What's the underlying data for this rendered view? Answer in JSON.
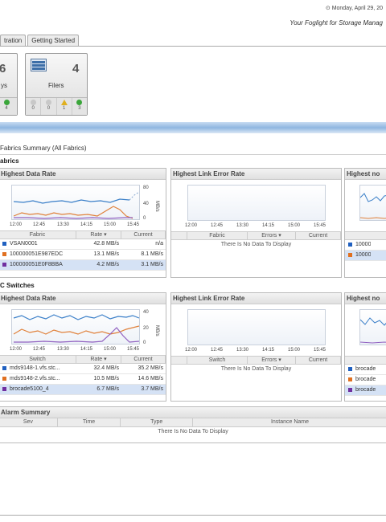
{
  "header": {
    "date": "Monday, April 29, 20",
    "tagline": "Your Foglight for Storage Manag"
  },
  "tabs": [
    {
      "label": "tration"
    },
    {
      "label": "Getting Started"
    }
  ],
  "tiles": {
    "arrays": {
      "count": "6",
      "name": "ys",
      "stat_last": "4"
    },
    "filers": {
      "count": "4",
      "name": "Filers",
      "stats": [
        "0",
        "0",
        "1",
        "3"
      ]
    }
  },
  "summary_title": "Fabrics Summary (All Fabrics)",
  "fabrics": {
    "section_title": "abrics",
    "rate_panel": {
      "title": "Highest Data Rate",
      "y_unit": "MB/s",
      "y_ticks": [
        "80",
        "40",
        "0"
      ],
      "x_ticks": [
        "12:00",
        "12:45",
        "13:30",
        "14:15",
        "15:00",
        "15:45"
      ],
      "columns": [
        "Fabric",
        "Rate ▾",
        "Current"
      ],
      "rows": [
        {
          "name": "VSAN0001",
          "rate": "42.8 MB/s",
          "current": "n/a",
          "color": "#2060c0"
        },
        {
          "name": "100000051E987EDC",
          "rate": "13.1 MB/s",
          "current": "8.1 MB/s",
          "color": "#e07020"
        },
        {
          "name": "100000051E0F8BBA",
          "rate": "4.2 MB/s",
          "current": "3.1 MB/s",
          "color": "#7030a0"
        }
      ]
    },
    "error_panel": {
      "title": "Highest Link Error Rate",
      "x_ticks": [
        "12:00",
        "12:45",
        "13:30",
        "14:15",
        "15:00",
        "15:45"
      ],
      "columns": [
        "Fabric",
        "Errors ▾",
        "Current"
      ],
      "nodata": "There Is No Data To Display"
    },
    "third_panel": {
      "title": "Highest no",
      "rows": [
        "10000",
        "10000"
      ]
    }
  },
  "switches": {
    "section_title": "C Switches",
    "rate_panel": {
      "title": "Highest Data Rate",
      "y_unit": "MB/s",
      "y_ticks": [
        "40",
        "20",
        "0"
      ],
      "x_ticks": [
        "12:00",
        "12:45",
        "13:30",
        "14:15",
        "15:00",
        "15:45"
      ],
      "columns": [
        "Switch",
        "Rate ▾",
        "Current"
      ],
      "rows": [
        {
          "name": "mds9148-1.vfs.stc...",
          "rate": "32.4 MB/s",
          "current": "35.2 MB/s",
          "color": "#2060c0"
        },
        {
          "name": "mds9148-2.vfs.stc...",
          "rate": "10.5 MB/s",
          "current": "14.6 MB/s",
          "color": "#e07020"
        },
        {
          "name": "brocade5100_4",
          "rate": "6.7 MB/s",
          "current": "3.7 MB/s",
          "color": "#7030a0"
        }
      ]
    },
    "error_panel": {
      "title": "Highest Link Error Rate",
      "x_ticks": [
        "12:00",
        "12:45",
        "13:30",
        "14:15",
        "15:00",
        "15:45"
      ],
      "columns": [
        "Switch",
        "Errors ▾",
        "Current"
      ],
      "nodata": "There Is No Data To Display"
    },
    "third_panel": {
      "title": "Highest no",
      "rows": [
        "brocade",
        "brocade",
        "brocade"
      ]
    }
  },
  "alarm": {
    "title": "Alarm Summary",
    "columns": [
      "Sev",
      "Time",
      "Type",
      "Instance Name"
    ],
    "nodata": "There Is No Data To Display"
  }
}
